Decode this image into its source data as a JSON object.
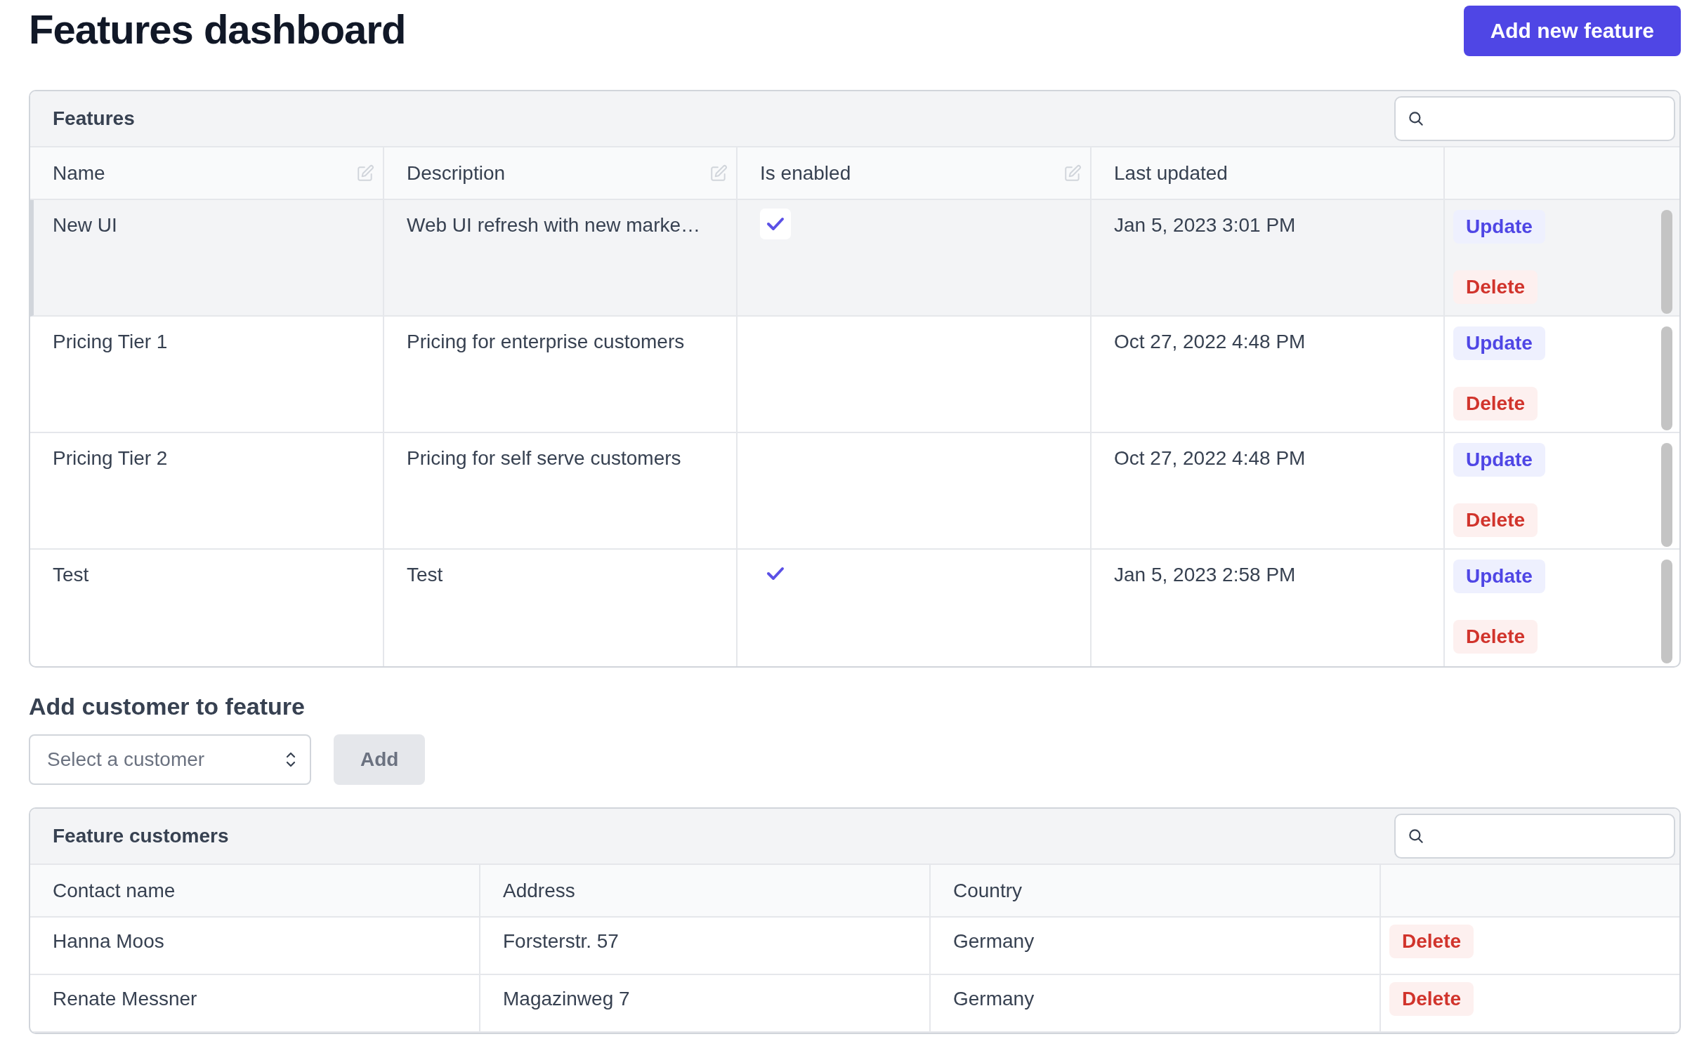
{
  "page": {
    "title": "Features dashboard",
    "add_button": "Add new feature"
  },
  "features_table": {
    "title": "Features",
    "columns": [
      {
        "label": "Name",
        "editable": true
      },
      {
        "label": "Description",
        "editable": true
      },
      {
        "label": "Is enabled",
        "editable": true
      },
      {
        "label": "Last updated",
        "editable": false
      }
    ],
    "rows": [
      {
        "name": "New UI",
        "description": "Web UI refresh with new marke…",
        "enabled": true,
        "last_updated": "Jan 5, 2023 3:01 PM",
        "selected": true,
        "actions": [
          {
            "kind": "update",
            "label": "Update"
          },
          {
            "kind": "delete",
            "label": "Delete"
          }
        ]
      },
      {
        "name": "Pricing Tier 1",
        "description": "Pricing for enterprise customers",
        "enabled": false,
        "last_updated": "Oct 27, 2022 4:48 PM",
        "selected": false,
        "actions": [
          {
            "kind": "update",
            "label": "Update"
          },
          {
            "kind": "delete",
            "label": "Delete"
          }
        ]
      },
      {
        "name": "Pricing Tier 2",
        "description": "Pricing for self serve customers",
        "enabled": false,
        "last_updated": "Oct 27, 2022 4:48 PM",
        "selected": false,
        "actions": [
          {
            "kind": "update",
            "label": "Update"
          },
          {
            "kind": "delete",
            "label": "Delete"
          }
        ]
      },
      {
        "name": "Test",
        "description": "Test",
        "enabled": true,
        "last_updated": "Jan 5, 2023 2:58 PM",
        "selected": false,
        "actions": [
          {
            "kind": "update",
            "label": "Update"
          },
          {
            "kind": "delete",
            "label": "Delete"
          }
        ]
      }
    ]
  },
  "add_customer": {
    "heading": "Add customer to feature",
    "select_placeholder": "Select a customer",
    "button": "Add",
    "button_disabled": true
  },
  "customers_table": {
    "title": "Feature customers",
    "columns": [
      "Contact name",
      "Address",
      "Country"
    ],
    "rows": [
      {
        "contact_name": "Hanna Moos",
        "address": "Forsterstr. 57",
        "country": "Germany",
        "actions": [
          {
            "kind": "delete",
            "label": "Delete"
          }
        ]
      },
      {
        "contact_name": "Renate Messner",
        "address": "Magazinweg 7",
        "country": "Germany",
        "actions": [
          {
            "kind": "delete",
            "label": "Delete"
          }
        ]
      }
    ]
  }
}
